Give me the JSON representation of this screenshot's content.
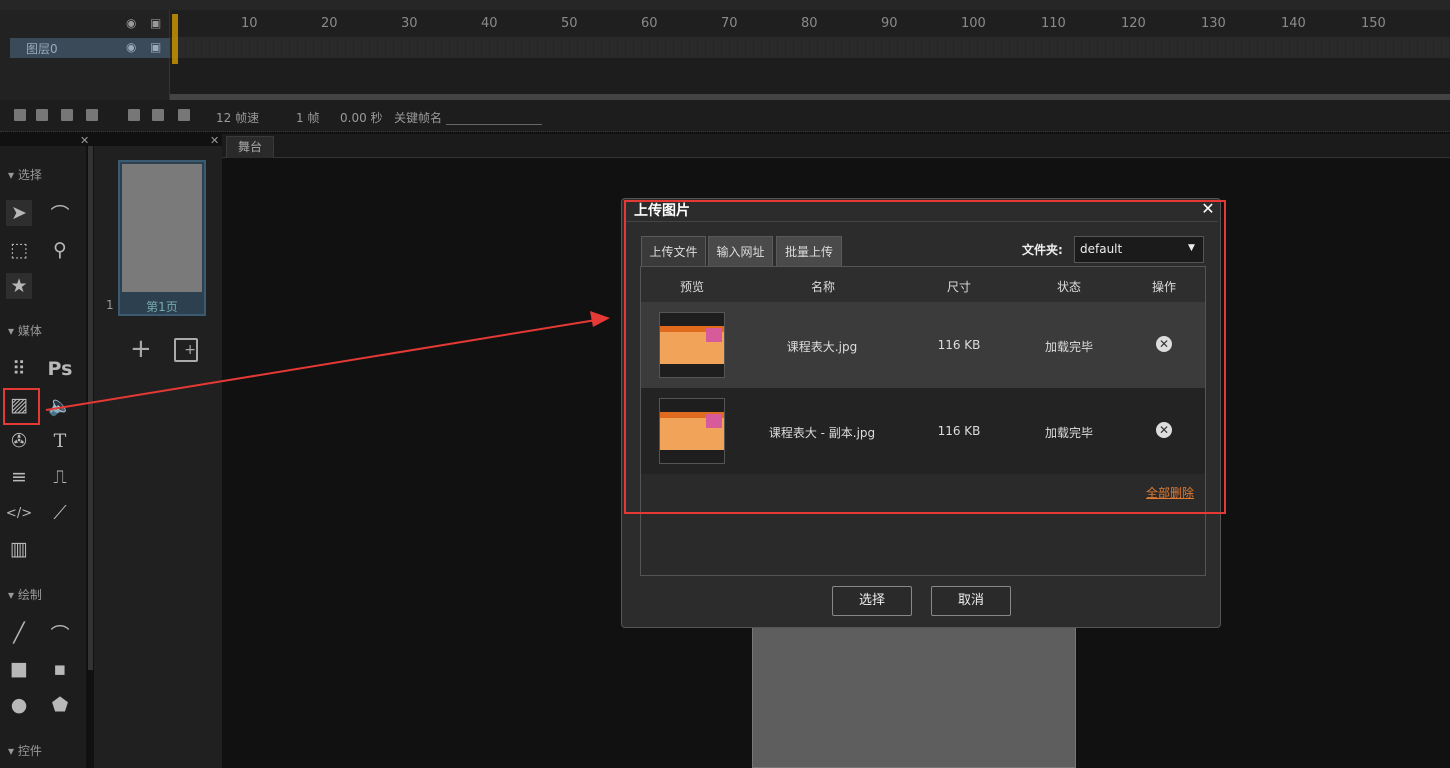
{
  "timeline": {
    "ruler_ticks": [
      "10",
      "20",
      "30",
      "40",
      "50",
      "60",
      "70",
      "80",
      "90",
      "100",
      "110",
      "120",
      "130",
      "140",
      "150"
    ],
    "layer_name": "图层0"
  },
  "statusbar": {
    "fps": "12 帧速",
    "frame": "1 帧",
    "time": "0.00 秒",
    "keyframe_label": "关键帧名"
  },
  "tools": {
    "section_select": "选择",
    "section_media": "媒体",
    "section_draw": "绘制",
    "section_controls": "控件",
    "ps_label": "Ps",
    "text_label": "T"
  },
  "pages": {
    "page_number": "1",
    "page_label": "第1页",
    "add_label": "+"
  },
  "stage": {
    "tab_label": "舞台"
  },
  "dialog": {
    "title": "上传图片",
    "close": "✕",
    "tabs": [
      "上传文件",
      "输入网址",
      "批量上传"
    ],
    "folder_label": "文件夹:",
    "folder_value": "default",
    "columns": [
      "预览",
      "名称",
      "尺寸",
      "状态",
      "操作"
    ],
    "files": [
      {
        "name": "课程表大.jpg",
        "size": "116 KB",
        "status": "加载完毕"
      },
      {
        "name": "课程表大 - 副本.jpg",
        "size": "116 KB",
        "status": "加载完毕"
      }
    ],
    "delete_all": "全部删除",
    "select_button": "选择",
    "cancel_button": "取消"
  },
  "colors": {
    "annotation": "#e53935",
    "delete_all": "#e07a33"
  }
}
